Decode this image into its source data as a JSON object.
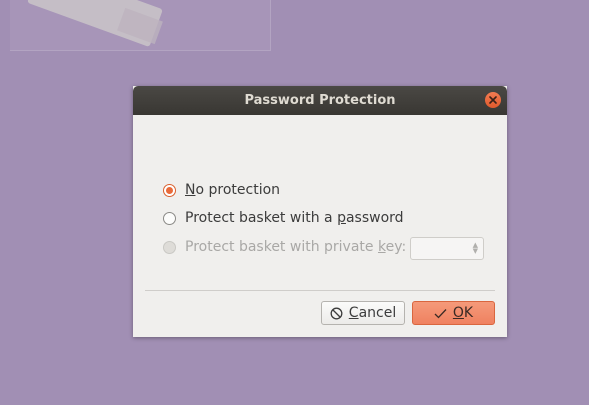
{
  "dialog": {
    "title": "Password Protection",
    "options": [
      {
        "pre": "",
        "mnemonic": "N",
        "post": "o protection",
        "checked": true,
        "enabled": true
      },
      {
        "pre": "Protect basket with a ",
        "mnemonic": "p",
        "post": "assword",
        "checked": false,
        "enabled": true
      },
      {
        "pre": "Protect basket with private ",
        "mnemonic": "k",
        "post": "ey:",
        "checked": false,
        "enabled": false
      }
    ],
    "key_select_value": "",
    "cancel": {
      "pre": "",
      "mnemonic": "C",
      "post": "ancel"
    },
    "ok": {
      "pre": "",
      "mnemonic": "O",
      "post": "K"
    }
  },
  "colors": {
    "desktop": "#a18fb4",
    "accent": "#e96a3a",
    "titlebar": "#3d3b37"
  },
  "icons": [
    "close-icon",
    "cancel-icon",
    "check-icon"
  ]
}
